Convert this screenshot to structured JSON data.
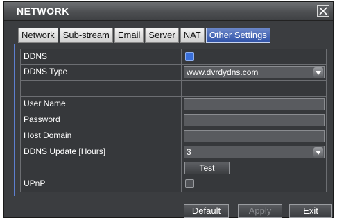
{
  "window": {
    "title": "NETWORK"
  },
  "tabs": [
    {
      "label": "Network"
    },
    {
      "label": "Sub-stream"
    },
    {
      "label": "Email"
    },
    {
      "label": "Server"
    },
    {
      "label": "NAT"
    },
    {
      "label": "Other Settings",
      "active": true
    }
  ],
  "form": {
    "ddns": {
      "label": "DDNS",
      "checked": true
    },
    "ddns_type": {
      "label": "DDNS Type",
      "value": "www.dvrdydns.com"
    },
    "user_name": {
      "label": "User Name",
      "value": ""
    },
    "password": {
      "label": "Password",
      "value": ""
    },
    "host_domain": {
      "label": "Host Domain",
      "value": ""
    },
    "ddns_update": {
      "label": "DDNS Update [Hours]",
      "value": "3"
    },
    "test_button": "Test",
    "upnp": {
      "label": "UPnP",
      "checked": false
    }
  },
  "buttons": {
    "default": "Default",
    "apply": "Apply",
    "exit": "Exit"
  },
  "colors": {
    "active_tab": "#3f5fb4",
    "panel_border": "#5d7fd0",
    "checkbox_on": "#3a6fd8"
  }
}
